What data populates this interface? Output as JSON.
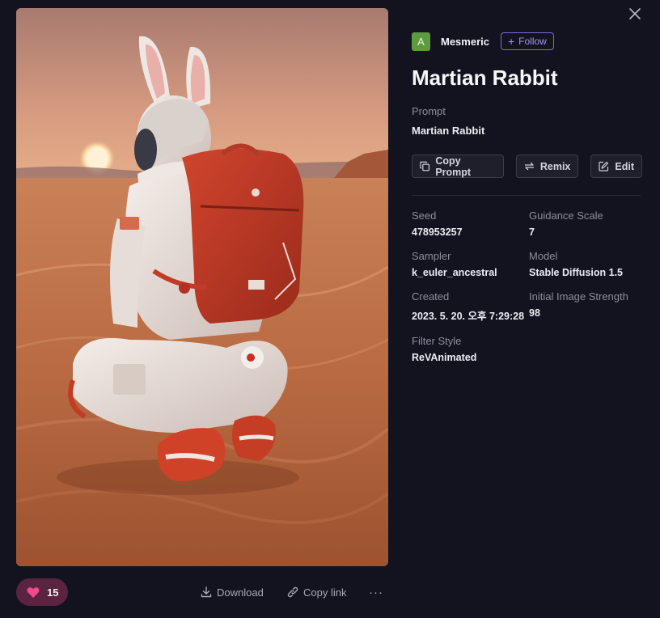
{
  "image": {
    "alt": "Martian Rabbit"
  },
  "author": {
    "avatar_letter": "A",
    "name": "Mesmeric",
    "follow_label": "Follow"
  },
  "title": "Martian Rabbit",
  "prompt": {
    "label": "Prompt",
    "value": "Martian Rabbit"
  },
  "actions": {
    "copy_prompt": "Copy Prompt",
    "remix": "Remix",
    "edit": "Edit"
  },
  "meta": [
    {
      "label": "Seed",
      "value": "478953257"
    },
    {
      "label": "Guidance Scale",
      "value": "7"
    },
    {
      "label": "Sampler",
      "value": "k_euler_ancestral"
    },
    {
      "label": "Model",
      "value": "Stable Diffusion 1.5"
    },
    {
      "label": "Created",
      "value": "2023. 5. 20. 오후 7:29:28"
    },
    {
      "label": "Initial Image Strength",
      "value": "98"
    },
    {
      "label": "Filter Style",
      "value": "ReVAnimated"
    }
  ],
  "bottom": {
    "like_count": "15",
    "download": "Download",
    "copy_link": "Copy link",
    "more": "···"
  },
  "colors": {
    "background": "#131320",
    "accent": "#7b6ae2",
    "like_bg": "#5a2340",
    "heart": "#f04a8c",
    "avatar": "#5c9c3c"
  },
  "icons": [
    "close-icon",
    "plus-icon",
    "copy-icon",
    "remix-icon",
    "edit-icon",
    "heart-icon",
    "download-icon",
    "link-icon"
  ]
}
